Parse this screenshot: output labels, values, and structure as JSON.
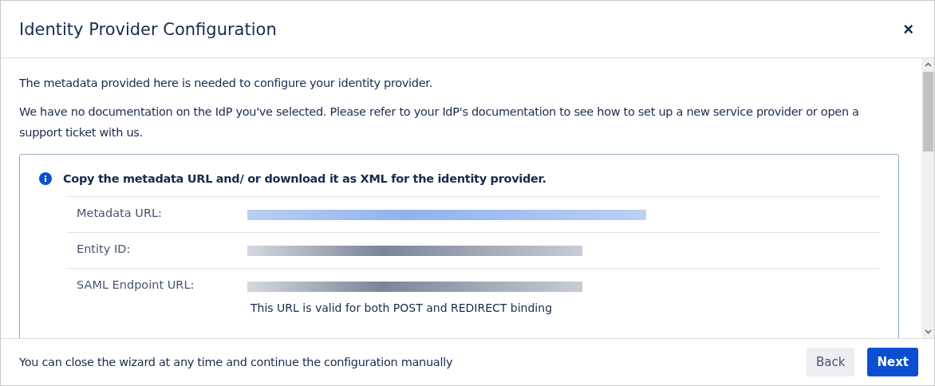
{
  "dialog": {
    "title": "Identity Provider Configuration",
    "close_label": "×"
  },
  "intro": [
    "The metadata provided here is needed to configure your identity provider.",
    "We have no documentation on the IdP you've selected. Please refer to your IdP's documentation to see how to set up a new service provider or open a support ticket with us."
  ],
  "info_panel": {
    "heading": "Copy the metadata URL and/ or download it as XML for the identity provider.",
    "rows": [
      {
        "label": "Metadata URL:",
        "kind": "link"
      },
      {
        "label": "Entity ID:",
        "kind": "text"
      },
      {
        "label": "SAML Endpoint URL:",
        "kind": "text",
        "note": "This URL is valid for both POST and REDIRECT binding"
      }
    ]
  },
  "footer": {
    "hint": "You can close the wizard at any time and continue the configuration manually",
    "buttons": [
      {
        "label": "Back",
        "kind": "secondary"
      },
      {
        "label": "Next",
        "kind": "primary"
      }
    ]
  }
}
